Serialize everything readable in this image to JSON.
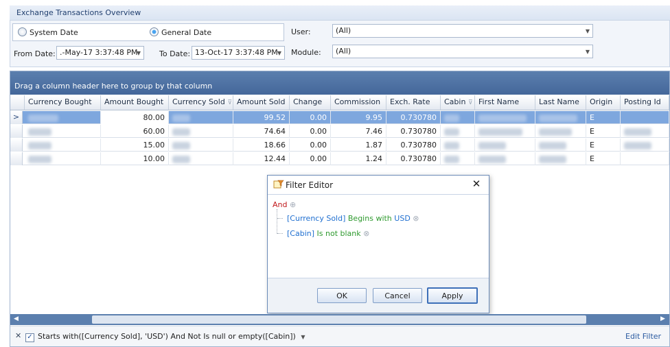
{
  "group": {
    "title": "Exchange Transactions Overview",
    "system_date_label": "System Date",
    "general_date_label": "General Date",
    "from_date_label": "From Date:",
    "from_date_value": ".-May-17 3:37:48 PM",
    "to_date_label": "To Date:",
    "to_date_value": "13-Oct-17 3:37:48 PM",
    "user_label": "User:",
    "user_value": "(All)",
    "module_label": "Module:",
    "module_value": "(All)"
  },
  "grid": {
    "group_hint": "Drag a column header here to group by that column",
    "columns": [
      "Currency Bought",
      "Amount Bought",
      "Currency Sold",
      "Amount Sold",
      "Change",
      "Commission",
      "Exch. Rate",
      "Cabin",
      "First Name",
      "Last Name",
      "Origin",
      "Posting Id"
    ],
    "rows": [
      {
        "amount_bought": "80.00",
        "amount_sold": "99.52",
        "change": "0.00",
        "commission": "9.95",
        "exch_rate": "0.730780",
        "origin": "E"
      },
      {
        "amount_bought": "60.00",
        "amount_sold": "74.64",
        "change": "0.00",
        "commission": "7.46",
        "exch_rate": "0.730780",
        "origin": "E"
      },
      {
        "amount_bought": "15.00",
        "amount_sold": "18.66",
        "change": "0.00",
        "commission": "1.87",
        "exch_rate": "0.730780",
        "origin": "E"
      },
      {
        "amount_bought": "10.00",
        "amount_sold": "12.44",
        "change": "0.00",
        "commission": "1.24",
        "exch_rate": "0.730780",
        "origin": "E"
      }
    ]
  },
  "dialog": {
    "title": "Filter Editor",
    "and_label": "And",
    "cond1_field": "[Currency Sold]",
    "cond1_op": "Begins with",
    "cond1_value": "USD",
    "cond2_field": "[Cabin]",
    "cond2_op": "Is not blank",
    "ok": "OK",
    "cancel": "Cancel",
    "apply": "Apply"
  },
  "filter_panel": {
    "expression": "Starts with([Currency Sold], 'USD') And Not Is null or empty([Cabin])",
    "edit_filter": "Edit Filter"
  },
  "colors": {
    "header_band": "#44679a",
    "selected_row": "#7ea7de",
    "and_text": "#c0181b",
    "condition_text": "#1f6fd0",
    "operator_text": "#2f9a2f"
  }
}
